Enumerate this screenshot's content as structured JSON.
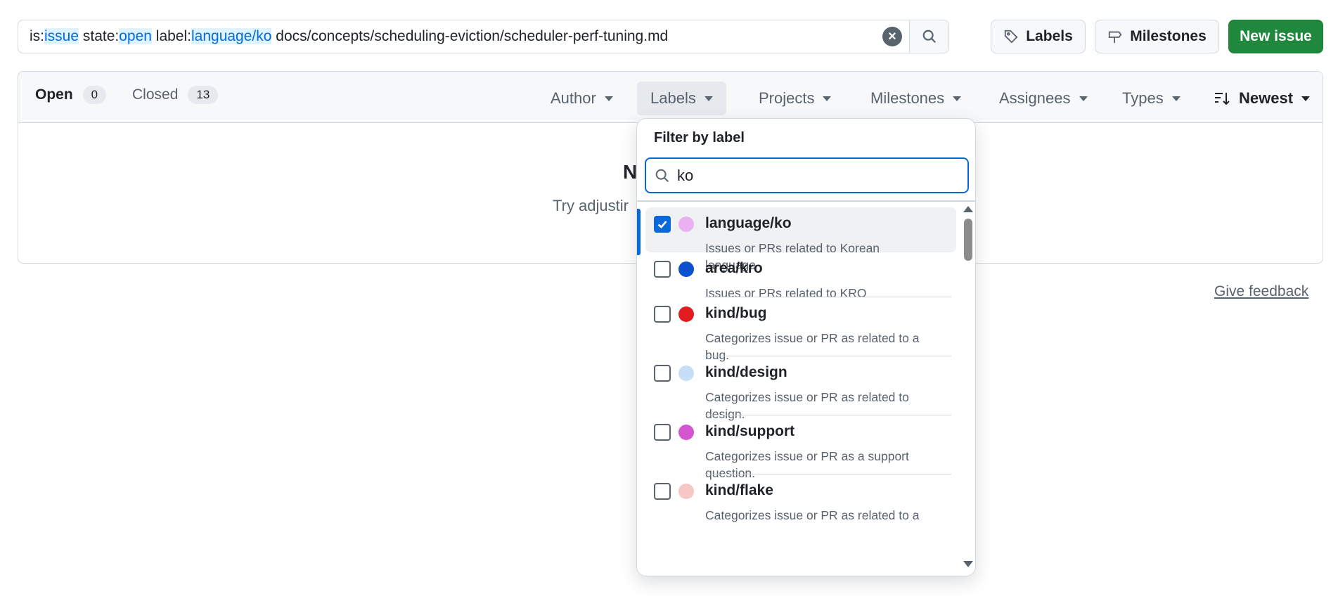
{
  "search": {
    "parts": [
      {
        "text": "is:",
        "hl": false
      },
      {
        "text": "issue",
        "hl": true
      },
      {
        "text": " state:",
        "hl": false
      },
      {
        "text": "open",
        "hl": true
      },
      {
        "text": " label:",
        "hl": false
      },
      {
        "text": "language/ko",
        "hl": true
      },
      {
        "text": " docs/concepts/scheduling-eviction/scheduler-perf-tuning.md",
        "hl": false
      }
    ]
  },
  "toolbar": {
    "labels_label": "Labels",
    "milestones_label": "Milestones",
    "new_issue_label": "New issue"
  },
  "states": {
    "open_label": "Open",
    "open_count": "0",
    "closed_label": "Closed",
    "closed_count": "13"
  },
  "filters": {
    "author": "Author",
    "labels": "Labels",
    "projects": "Projects",
    "milestones": "Milestones",
    "assignees": "Assignees",
    "types": "Types",
    "sort": "Newest"
  },
  "empty": {
    "title": "N",
    "text": "Try adjustir"
  },
  "feedback_label": "Give feedback",
  "label_filter": {
    "title": "Filter by label",
    "query": "ko",
    "options": [
      {
        "name": "language/ko",
        "desc": "Issues or PRs related to Korean language",
        "color": "#e9b1f2",
        "checked": true
      },
      {
        "name": "area/kro",
        "desc": "Issues or PRs related to KRO",
        "color": "#0b52cc",
        "checked": false
      },
      {
        "name": "kind/bug",
        "desc": "Categorizes issue or PR as related to a bug.",
        "color": "#e11d21",
        "checked": false
      },
      {
        "name": "kind/design",
        "desc": "Categorizes issue or PR as related to design.",
        "color": "#c7def8",
        "checked": false
      },
      {
        "name": "kind/support",
        "desc": "Categorizes issue or PR as a support question.",
        "color": "#d455d0",
        "checked": false
      },
      {
        "name": "kind/flake",
        "desc": "Categorizes issue or PR as related to a",
        "color": "#f7c6c7",
        "checked": false
      }
    ]
  }
}
